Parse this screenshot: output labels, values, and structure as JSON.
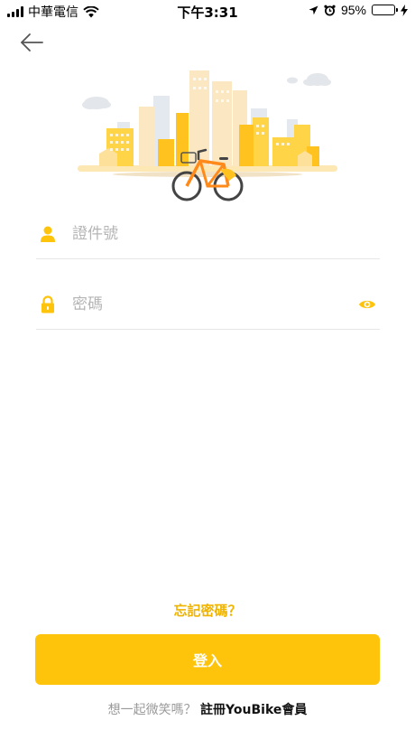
{
  "status_bar": {
    "carrier": "中華電信",
    "time": "下午3:31",
    "battery_percent": "95%",
    "battery_level": 0.95,
    "battery_color": "#4cd964"
  },
  "nav": {
    "back_icon": "arrow-left-icon"
  },
  "illustration": {
    "name": "city-bike-illustration"
  },
  "form": {
    "id_field": {
      "icon": "user-icon",
      "placeholder": "證件號",
      "value": ""
    },
    "password_field": {
      "icon": "lock-icon",
      "placeholder": "密碼",
      "value": "",
      "toggle_icon": "eye-icon"
    }
  },
  "forgot_password": "忘記密碼？",
  "login_button": "登入",
  "register": {
    "prompt": "想一起微笑嗎？ ",
    "link": "註冊YouBike會員"
  },
  "colors": {
    "accent": "#fec40b",
    "accent_text": "#f0b400"
  }
}
